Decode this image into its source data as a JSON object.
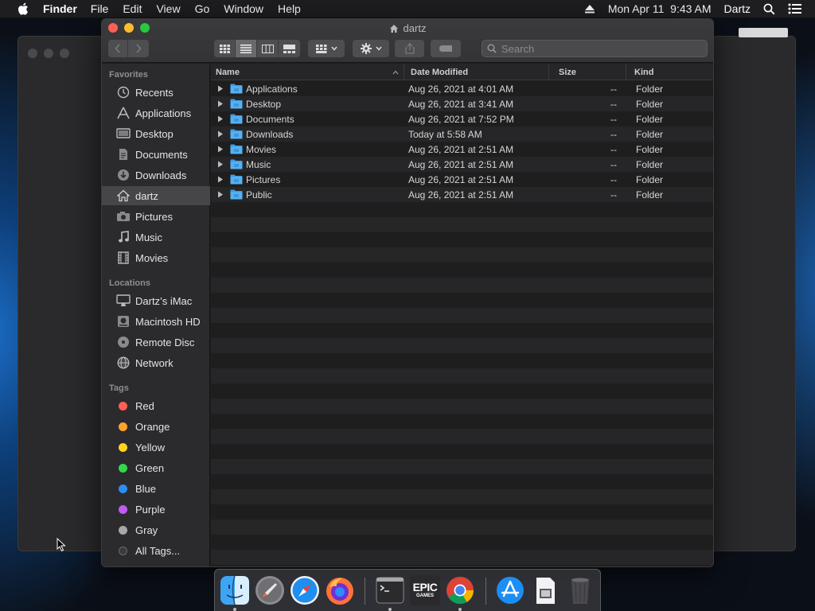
{
  "menubar": {
    "apple_icon": "apple-icon",
    "app_name": "Finder",
    "menus": [
      "File",
      "Edit",
      "View",
      "Go",
      "Window",
      "Help"
    ],
    "clock": "Mon Apr 11  9:43 AM",
    "user": "Dartz"
  },
  "window": {
    "title": "dartz",
    "search_placeholder": "Search"
  },
  "sidebar": {
    "favorites_header": "Favorites",
    "favorites": [
      {
        "label": "Recents",
        "icon": "clock-icon"
      },
      {
        "label": "Applications",
        "icon": "applications-icon"
      },
      {
        "label": "Desktop",
        "icon": "desktop-icon"
      },
      {
        "label": "Documents",
        "icon": "document-icon"
      },
      {
        "label": "Downloads",
        "icon": "download-icon"
      },
      {
        "label": "dartz",
        "icon": "home-icon",
        "selected": true
      },
      {
        "label": "Pictures",
        "icon": "camera-icon"
      },
      {
        "label": "Music",
        "icon": "music-icon"
      },
      {
        "label": "Movies",
        "icon": "film-icon"
      }
    ],
    "locations_header": "Locations",
    "locations": [
      {
        "label": "Dartz’s iMac",
        "icon": "imac-icon"
      },
      {
        "label": "Macintosh HD",
        "icon": "disk-icon"
      },
      {
        "label": "Remote Disc",
        "icon": "disc-icon"
      },
      {
        "label": "Network",
        "icon": "globe-icon"
      }
    ],
    "tags_header": "Tags",
    "tags": [
      {
        "label": "Red",
        "color": "#ff5f57"
      },
      {
        "label": "Orange",
        "color": "#ffa42b"
      },
      {
        "label": "Yellow",
        "color": "#ffd51d"
      },
      {
        "label": "Green",
        "color": "#33d74b"
      },
      {
        "label": "Blue",
        "color": "#2f8cf0"
      },
      {
        "label": "Purple",
        "color": "#bf5af2"
      },
      {
        "label": "Gray",
        "color": "#a7a7aa"
      },
      {
        "label": "All Tags...",
        "color": "#555558"
      }
    ]
  },
  "columns": {
    "name": "Name",
    "date": "Date Modified",
    "size": "Size",
    "kind": "Kind"
  },
  "files": [
    {
      "name": "Applications",
      "date": "Aug 26, 2021 at 4:01 AM",
      "size": "--",
      "kind": "Folder"
    },
    {
      "name": "Desktop",
      "date": "Aug 26, 2021 at 3:41 AM",
      "size": "--",
      "kind": "Folder"
    },
    {
      "name": "Documents",
      "date": "Aug 26, 2021 at 7:52 PM",
      "size": "--",
      "kind": "Folder"
    },
    {
      "name": "Downloads",
      "date": "Today at 5:58 AM",
      "size": "--",
      "kind": "Folder"
    },
    {
      "name": "Movies",
      "date": "Aug 26, 2021 at 2:51 AM",
      "size": "--",
      "kind": "Folder"
    },
    {
      "name": "Music",
      "date": "Aug 26, 2021 at 2:51 AM",
      "size": "--",
      "kind": "Folder"
    },
    {
      "name": "Pictures",
      "date": "Aug 26, 2021 at 2:51 AM",
      "size": "--",
      "kind": "Folder"
    },
    {
      "name": "Public",
      "date": "Aug 26, 2021 at 2:51 AM",
      "size": "--",
      "kind": "Folder"
    }
  ],
  "dock": {
    "apps": [
      "Finder",
      "Launchpad",
      "Safari",
      "Firefox",
      "Terminal",
      "Epic Games",
      "Chrome",
      "App Store",
      "Preview",
      "Trash"
    ],
    "epic_text_top": "EPIC",
    "epic_text_bottom": "GAMES"
  },
  "colors": {
    "accent_folder": "#3b9ee8",
    "close": "#fe5f57",
    "minimize": "#febc2e",
    "maximize": "#28c840"
  }
}
